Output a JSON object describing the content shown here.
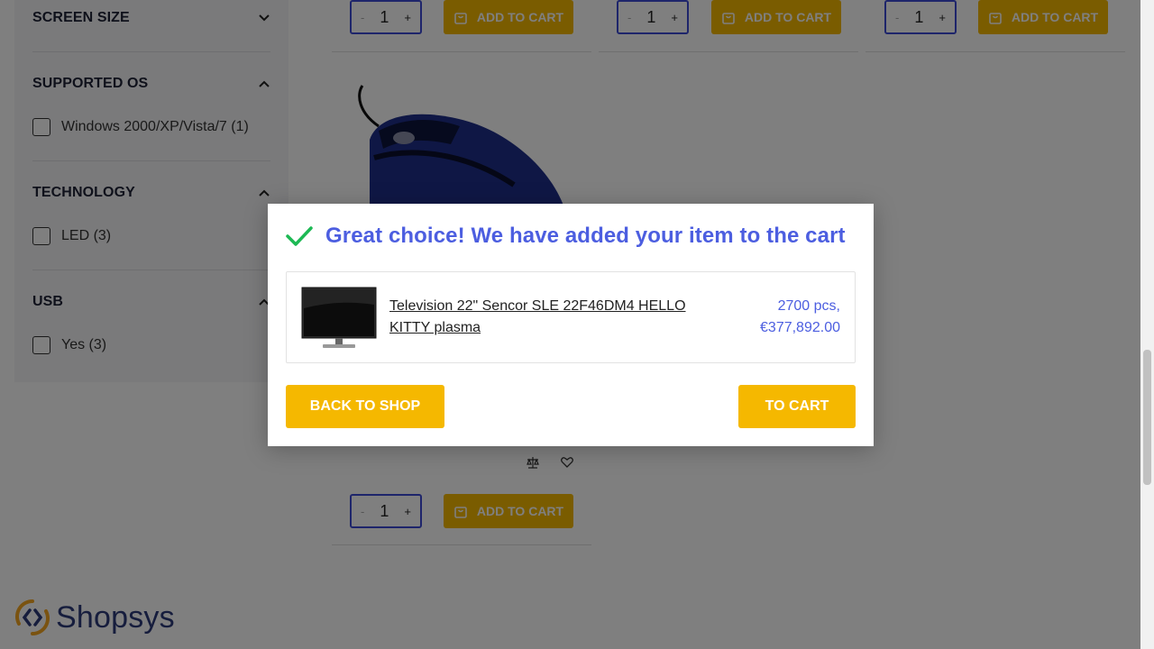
{
  "sidebar": {
    "filters": [
      {
        "title": "SCREEN SIZE",
        "expanded": false,
        "options": []
      },
      {
        "title": "SUPPORTED OS",
        "expanded": true,
        "options": [
          {
            "label": "Windows 2000/XP/Vista/7 (1)",
            "checked": false
          }
        ]
      },
      {
        "title": "TECHNOLOGY",
        "expanded": true,
        "options": [
          {
            "label": "LED (3)",
            "checked": false
          }
        ]
      },
      {
        "title": "USB",
        "expanded": true,
        "options": [
          {
            "label": "Yes (3)",
            "checked": false
          }
        ]
      }
    ]
  },
  "products": {
    "tiles": [
      {
        "quantity": "1",
        "minus": "-",
        "plus": "+",
        "add_to_cart": "ADD TO CART"
      },
      {
        "quantity": "1",
        "minus": "-",
        "plus": "+",
        "add_to_cart": "ADD TO CART"
      },
      {
        "quantity": "1",
        "minus": "-",
        "plus": "+",
        "add_to_cart": "ADD TO CART"
      },
      {
        "quantity": "1",
        "minus": "-",
        "plus": "+",
        "add_to_cart": "ADD TO CART",
        "icons": [
          "compare-icon",
          "heart-icon"
        ]
      }
    ]
  },
  "logo": {
    "text": "Shopsys"
  },
  "modal": {
    "title": "Great choice! We have added your item to the cart",
    "item": {
      "name": "Television 22\" Sencor SLE 22F46DM4 HELLO KITTY plasma",
      "quantity": "2700 pcs,",
      "price": "€377,892.00"
    },
    "back_button": "BACK TO SHOP",
    "cart_button": "TO CART"
  },
  "colors": {
    "accent": "#f5b800",
    "brand_blue": "#4c5ee0",
    "check_green": "#1db954"
  }
}
